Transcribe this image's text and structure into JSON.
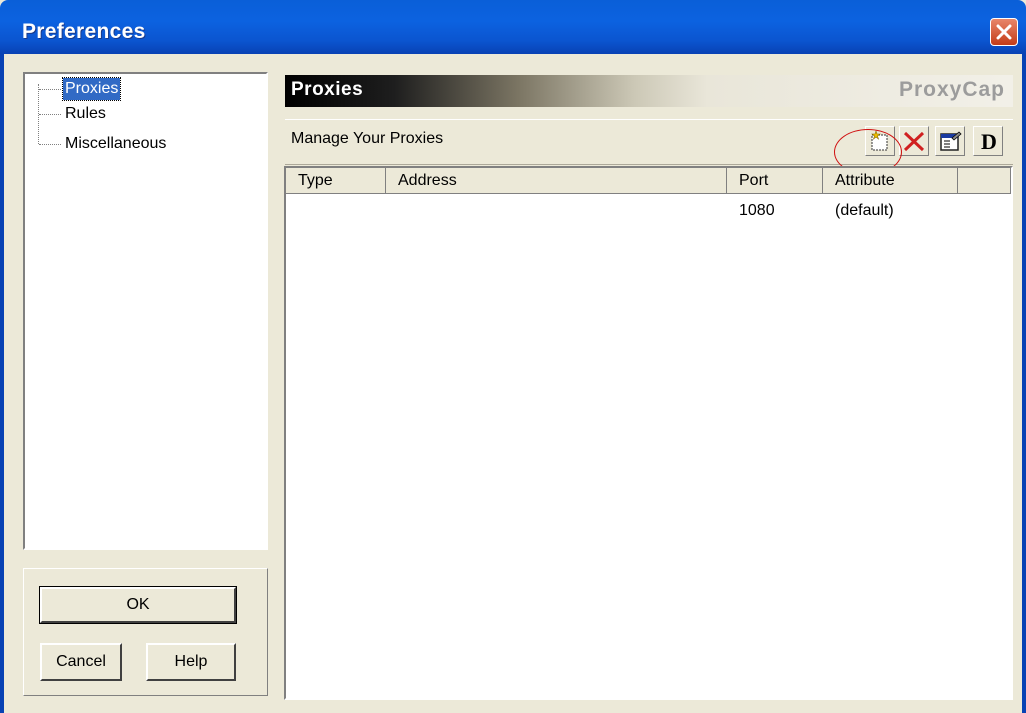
{
  "window": {
    "title": "Preferences",
    "close_icon": "close-icon"
  },
  "sidebar": {
    "items": [
      {
        "label": "Proxies",
        "selected": true
      },
      {
        "label": "Rules",
        "selected": false
      },
      {
        "label": "Miscellaneous",
        "selected": false
      }
    ]
  },
  "buttons": {
    "ok": "OK",
    "cancel": "Cancel",
    "help": "Help"
  },
  "panel": {
    "title": "Proxies",
    "brand": "ProxyCap",
    "subtitle": "Manage Your Proxies",
    "toolbar": [
      {
        "name": "new-proxy-icon"
      },
      {
        "name": "delete-icon"
      },
      {
        "name": "properties-icon"
      },
      {
        "name": "default-icon",
        "glyph": "D"
      }
    ]
  },
  "table": {
    "columns": [
      "Type",
      "Address",
      "Port",
      "Attribute"
    ],
    "rows": [
      {
        "type": "",
        "address": "",
        "port": "1080",
        "attribute": "(default)"
      }
    ]
  },
  "colors": {
    "titlebar": "#0c62e0",
    "selection": "#316ac5",
    "annotation": "#d01010"
  }
}
